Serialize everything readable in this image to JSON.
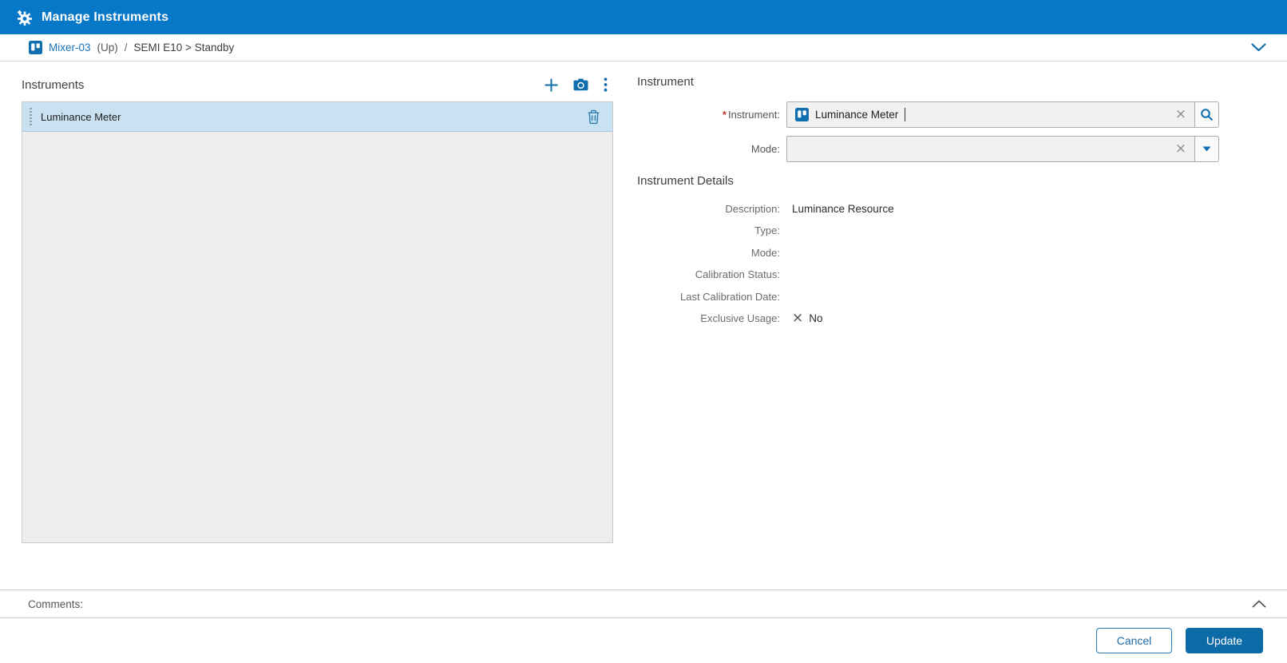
{
  "window": {
    "title": "Manage Instruments"
  },
  "breadcrumb": {
    "equipment": "Mixer-03",
    "direction": "(Up)",
    "separator": "/",
    "state_path": "SEMI E10 > Standby"
  },
  "instruments_panel": {
    "title": "Instruments",
    "items": [
      {
        "name": "Luminance Meter",
        "selected": true
      }
    ]
  },
  "instrument_form": {
    "title": "Instrument",
    "instrument_field": {
      "required_marker": "*",
      "label": "Instrument:",
      "value": "Luminance Meter"
    },
    "mode_field": {
      "label": "Mode:",
      "value": ""
    },
    "details": {
      "title": "Instrument Details",
      "rows": [
        {
          "label": "Description:",
          "value": "Luminance Resource"
        },
        {
          "label": "Type:",
          "value": ""
        },
        {
          "label": "Mode:",
          "value": ""
        },
        {
          "label": "Calibration Status:",
          "value": ""
        },
        {
          "label": "Last Calibration Date:",
          "value": ""
        },
        {
          "label": "Exclusive Usage:",
          "value": "No"
        }
      ]
    }
  },
  "comments": {
    "label": "Comments:"
  },
  "footer": {
    "cancel_label": "Cancel",
    "update_label": "Update"
  },
  "colors": {
    "titlebar": "#0778c8",
    "accent": "#0f6eae",
    "link": "#1a72b8",
    "selected_row": "#c9e2f2",
    "field_bg": "#f1f1f1",
    "update_button": "#0c6ba6",
    "required": "#c0392b"
  }
}
